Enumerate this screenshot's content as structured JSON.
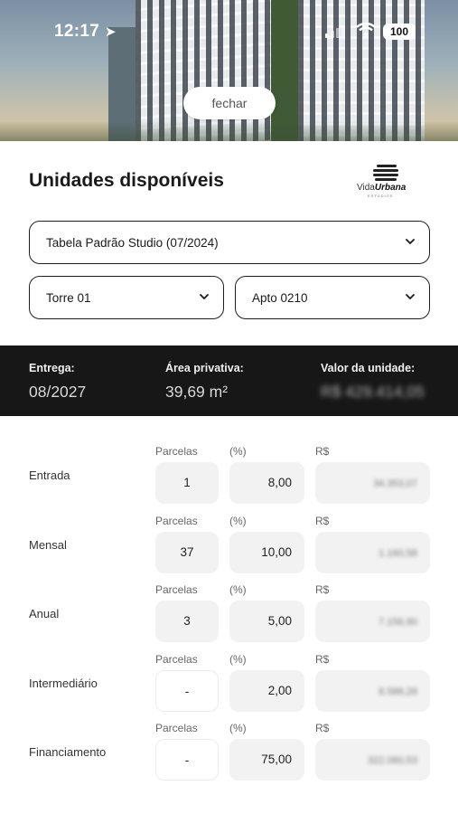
{
  "status_bar": {
    "time": "12:17",
    "battery": "100"
  },
  "header": {
    "close_label": "fechar"
  },
  "title": "Unidades disponíveis",
  "logo": {
    "brand_light": "Vida",
    "brand_bold": "Urbana",
    "tagline": "ESTÚDIOS"
  },
  "selects": {
    "table": "Tabela Padrão Studio (07/2024)",
    "tower": "Torre 01",
    "apartment": "Apto 0210"
  },
  "summary": {
    "delivery_label": "Entrega:",
    "delivery_value": "08/2027",
    "area_label": "Área privativa:",
    "area_value": "39,69 m²",
    "price_label": "Valor da unidade:",
    "price_value": "R$ 429.414,05"
  },
  "columns": {
    "installments": "Parcelas",
    "percent": "(%)",
    "amount": "R$"
  },
  "payments": [
    {
      "label": "Entrada",
      "installments": "1",
      "percent": "8,00",
      "amount": "34.353,07",
      "empty": false
    },
    {
      "label": "Mensal",
      "installments": "37",
      "percent": "10,00",
      "amount": "1.160,58",
      "empty": false
    },
    {
      "label": "Anual",
      "installments": "3",
      "percent": "5,00",
      "amount": "7.156,90",
      "empty": false
    },
    {
      "label": "Intermediário",
      "installments": "-",
      "percent": "2,00",
      "amount": "8.588,28",
      "empty": true
    },
    {
      "label": "Financiamento",
      "installments": "-",
      "percent": "75,00",
      "amount": "322.060,53",
      "empty": true
    }
  ]
}
